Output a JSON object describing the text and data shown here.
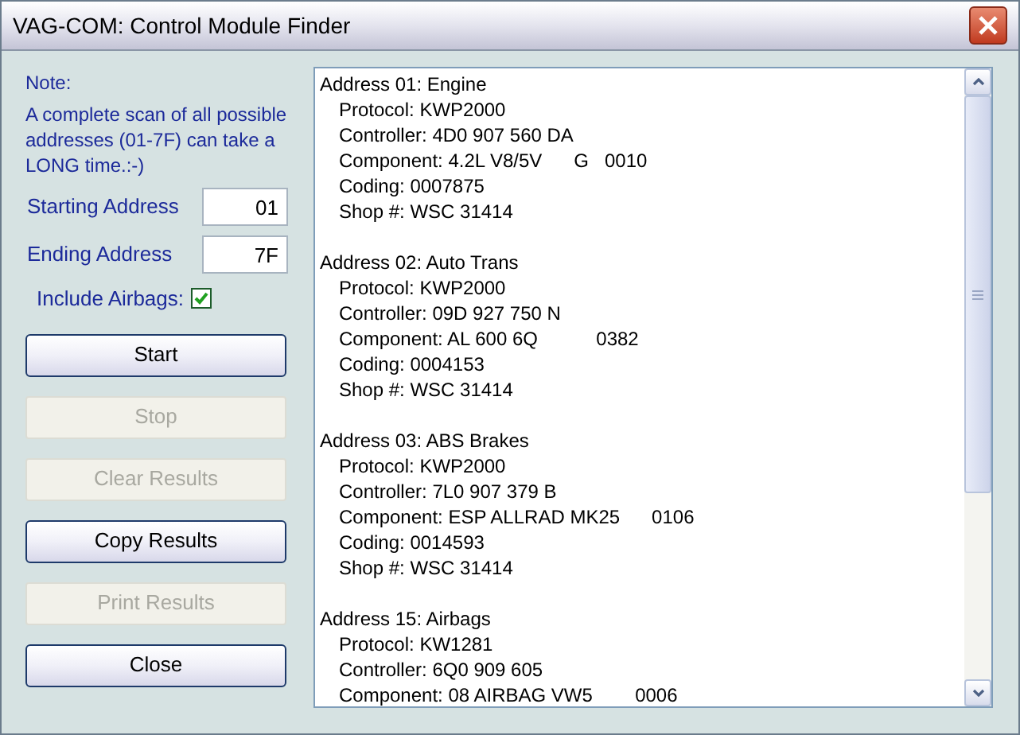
{
  "window": {
    "title": "VAG-COM:  Control Module Finder"
  },
  "note": {
    "label": "Note:",
    "text": "A complete scan of all possible addresses (01-7F) can take a LONG time.:-)"
  },
  "fields": [
    {
      "label": "Starting Address",
      "value": "01"
    },
    {
      "label": "Ending Address",
      "value": "7F"
    }
  ],
  "include_airbags": {
    "label": "Include Airbags:",
    "checked": true
  },
  "buttons": [
    {
      "label": "Start",
      "disabled": false
    },
    {
      "label": "Stop",
      "disabled": true
    },
    {
      "label": "Clear Results",
      "disabled": true
    },
    {
      "label": "Copy Results",
      "disabled": false
    },
    {
      "label": "Print Results",
      "disabled": true
    },
    {
      "label": "Close",
      "disabled": false
    }
  ],
  "results": [
    {
      "header": "Address 01: Engine",
      "lines": [
        "Protocol: KWP2000",
        "Controller: 4D0 907 560 DA",
        "Component: 4.2L V8/5V      G   0010",
        "Coding: 0007875",
        "Shop #: WSC 31414"
      ]
    },
    {
      "header": "Address 02: Auto Trans",
      "lines": [
        "Protocol: KWP2000",
        "Controller: 09D 927 750 N",
        "Component: AL 600 6Q           0382",
        "Coding: 0004153",
        "Shop #: WSC 31414"
      ]
    },
    {
      "header": "Address 03: ABS Brakes",
      "lines": [
        "Protocol: KWP2000",
        "Controller: 7L0 907 379 B",
        "Component: ESP ALLRAD MK25      0106",
        "Coding: 0014593",
        "Shop #: WSC 31414"
      ]
    },
    {
      "header": "Address 15: Airbags",
      "lines": [
        "Protocol: KW1281",
        "Controller: 6Q0 909 605",
        "Component: 08 AIRBAG VW5        0006"
      ]
    }
  ]
}
